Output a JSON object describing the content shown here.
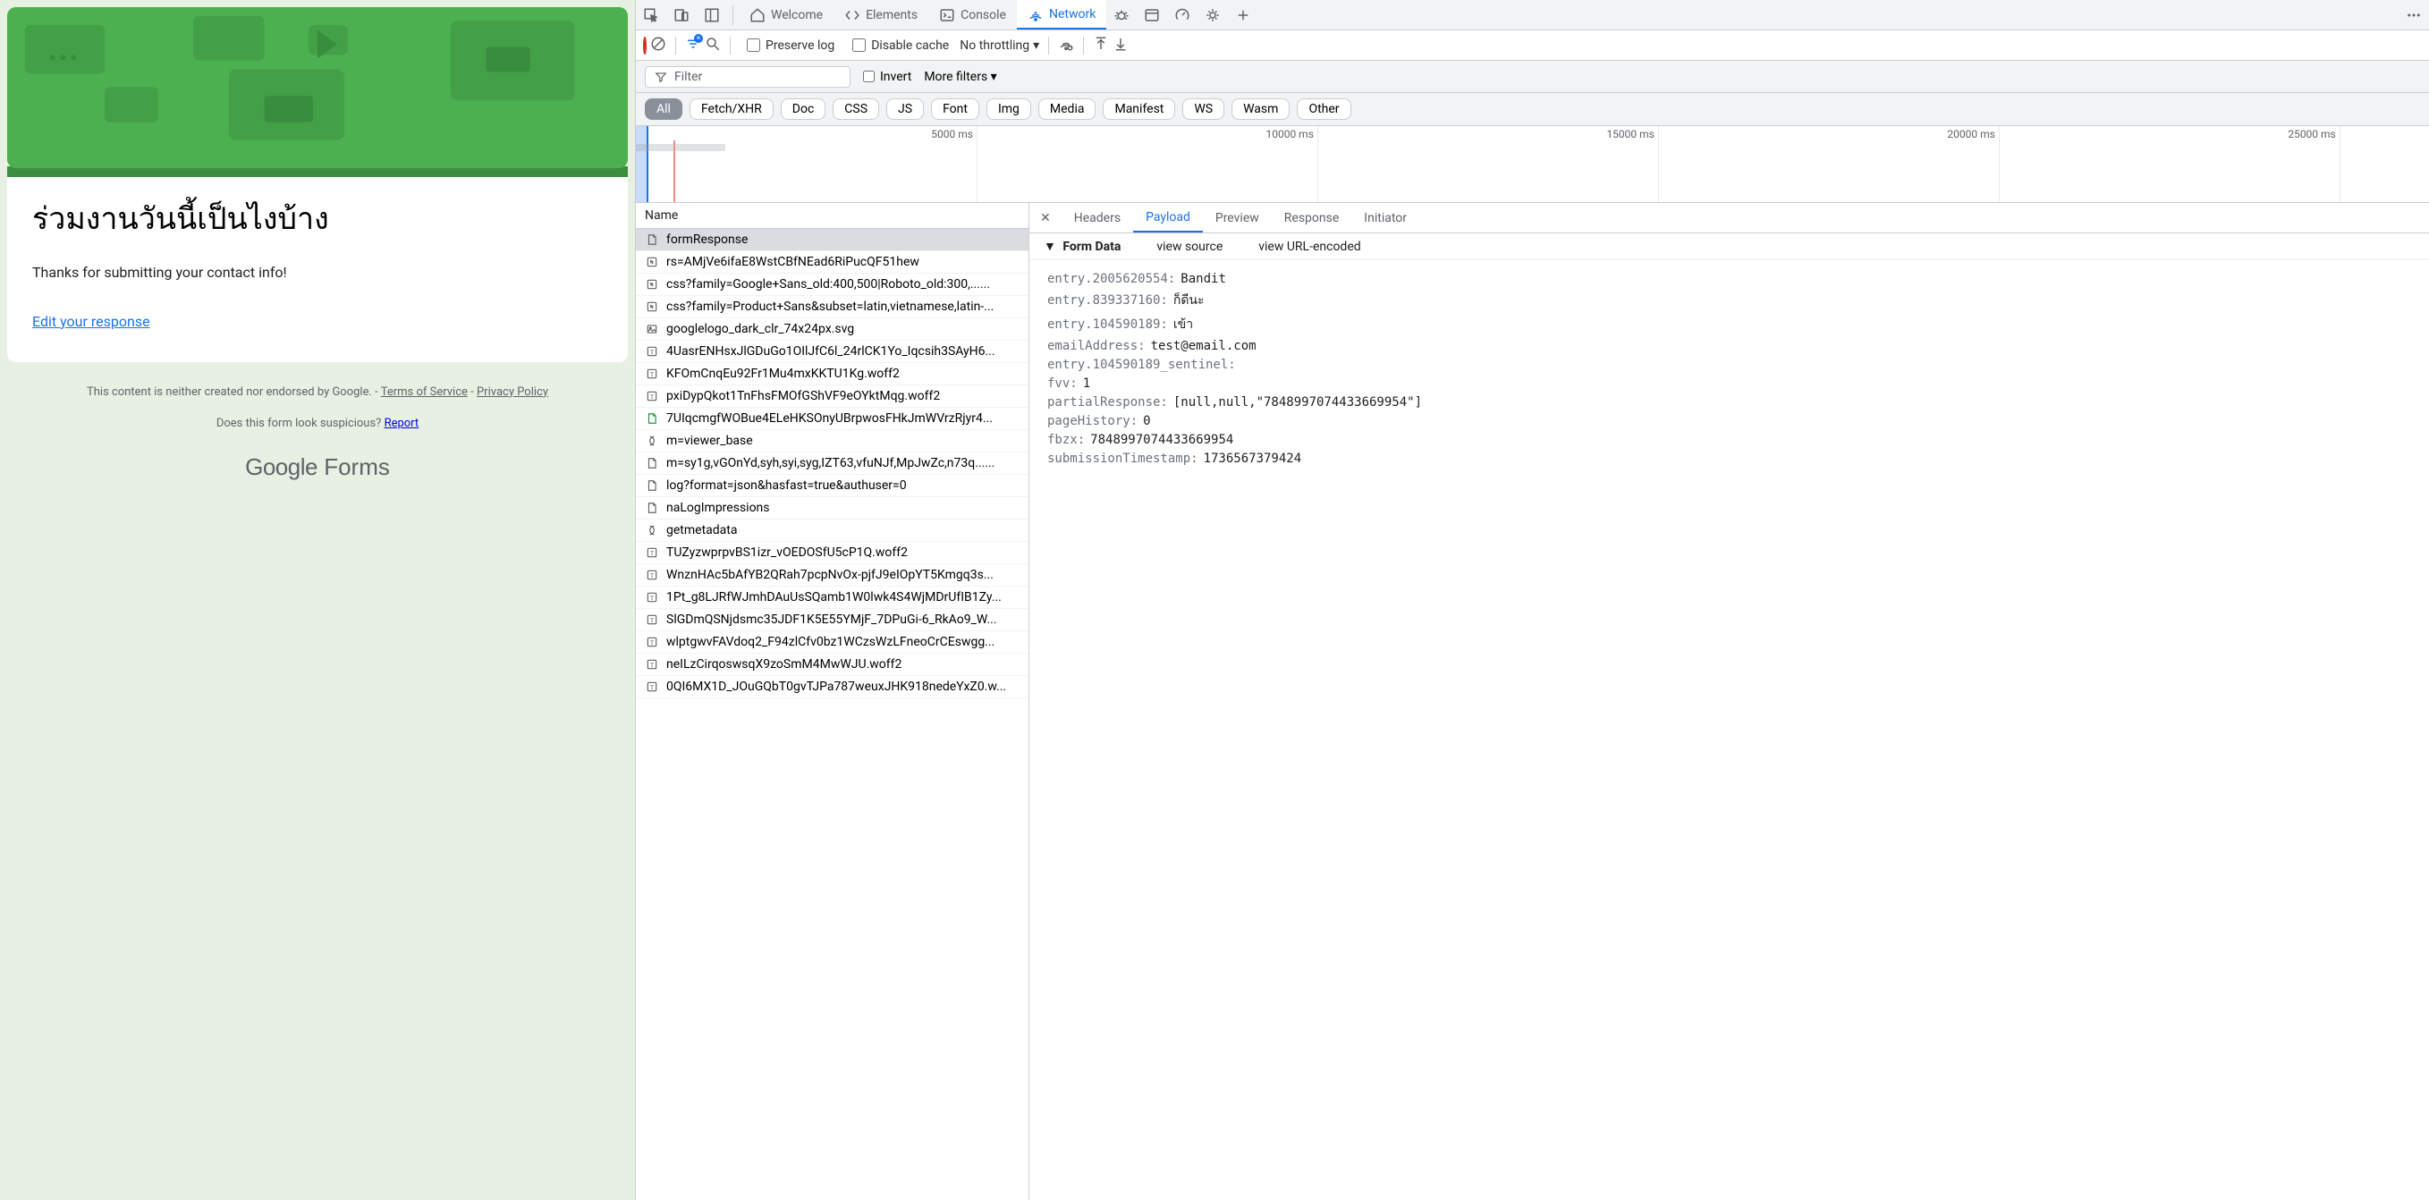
{
  "form": {
    "title": "ร่วมงานวันนี้เป็นไงบ้าง",
    "msg": "Thanks for submitting your contact info!",
    "edit": "Edit your response",
    "footer_prefix": "This content is neither created nor endorsed by Google. - ",
    "tos": "Terms of Service",
    "sep": " - ",
    "privacy": "Privacy Policy",
    "suspicious": "Does this form look suspicious? ",
    "report": "Report",
    "logo_g": "Google",
    "logo_f": " Forms"
  },
  "devtools": {
    "tabs": {
      "welcome": "Welcome",
      "elements": "Elements",
      "console": "Console",
      "network": "Network"
    },
    "toolbar": {
      "preserve": "Preserve log",
      "disable_cache": "Disable cache",
      "throttling": "No throttling"
    },
    "filterbar": {
      "filter": "Filter",
      "invert": "Invert",
      "more": "More filters"
    },
    "chips": [
      "All",
      "Fetch/XHR",
      "Doc",
      "CSS",
      "JS",
      "Font",
      "Img",
      "Media",
      "Manifest",
      "WS",
      "Wasm",
      "Other"
    ],
    "timeline_ticks": [
      "5000 ms",
      "10000 ms",
      "15000 ms",
      "20000 ms",
      "25000 ms"
    ],
    "name_header": "Name",
    "requests": [
      {
        "icon": "doc",
        "name": "formResponse",
        "sel": true
      },
      {
        "icon": "redirect",
        "name": "rs=AMjVe6ifaE8WstCBfNEad6RiPucQF51hew"
      },
      {
        "icon": "redirect",
        "name": "css?family=Google+Sans_old:400,500|Roboto_old:300,......"
      },
      {
        "icon": "redirect",
        "name": "css?family=Product+Sans&subset=latin,vietnamese,latin-..."
      },
      {
        "icon": "img",
        "name": "googlelogo_dark_clr_74x24px.svg"
      },
      {
        "icon": "font",
        "name": "4UasrENHsxJlGDuGo1OIlJfC6l_24rlCK1Yo_Iqcsih3SAyH6..."
      },
      {
        "icon": "font",
        "name": "KFOmCnqEu92Fr1Mu4mxKKTU1Kg.woff2"
      },
      {
        "icon": "font",
        "name": "pxiDypQkot1TnFhsFMOfGShVF9eOYktMqg.woff2"
      },
      {
        "icon": "js",
        "name": "7UIqcmgfWOBue4ELeHKSOnyUBrpwosFHkJmWVrzRjyr4..."
      },
      {
        "icon": "xhr",
        "name": "m=viewer_base"
      },
      {
        "icon": "doc",
        "name": "m=sy1g,vGOnYd,syh,syi,syg,IZT63,vfuNJf,MpJwZc,n73q......"
      },
      {
        "icon": "doc",
        "name": "log?format=json&hasfast=true&authuser=0"
      },
      {
        "icon": "doc",
        "name": "naLogImpressions"
      },
      {
        "icon": "xhr",
        "name": "getmetadata"
      },
      {
        "icon": "font",
        "name": "TUZyzwprpvBS1izr_vOEDOSfU5cP1Q.woff2"
      },
      {
        "icon": "font",
        "name": "WnznHAc5bAfYB2QRah7pcpNvOx-pjfJ9eIOpYT5Kmgq3s..."
      },
      {
        "icon": "font",
        "name": "1Pt_g8LJRfWJmhDAuUsSQamb1W0lwk4S4WjMDrUfIB1Zy..."
      },
      {
        "icon": "font",
        "name": "SlGDmQSNjdsmc35JDF1K5E55YMjF_7DPuGi-6_RkAo9_W..."
      },
      {
        "icon": "font",
        "name": "wlptgwvFAVdoq2_F94zlCfv0bz1WCzsWzLFneoCrCEswgg..."
      },
      {
        "icon": "font",
        "name": "neILzCirqoswsqX9zoSmM4MwWJU.woff2"
      },
      {
        "icon": "font",
        "name": "0QI6MX1D_JOuGQbT0gvTJPa787weuxJHK918nedeYxZ0.w..."
      }
    ],
    "detail_tabs": {
      "headers": "Headers",
      "payload": "Payload",
      "preview": "Preview",
      "response": "Response",
      "initiator": "Initiator"
    },
    "formdata_title": "Form Data",
    "view_source": "view source",
    "view_url": "view URL-encoded",
    "payload": [
      {
        "k": "entry.2005620554:",
        "v": "Bandit"
      },
      {
        "k": "entry.839337160:",
        "v": "ก็ดีนะ"
      },
      {
        "k": "entry.104590189:",
        "v": "เข้า"
      },
      {
        "k": "emailAddress:",
        "v": "test@email.com"
      },
      {
        "k": "entry.104590189_sentinel:",
        "v": ""
      },
      {
        "k": "fvv:",
        "v": "1"
      },
      {
        "k": "partialResponse:",
        "v": "[null,null,\"7848997074433669954\"]"
      },
      {
        "k": "pageHistory:",
        "v": "0"
      },
      {
        "k": "fbzx:",
        "v": "7848997074433669954"
      },
      {
        "k": "submissionTimestamp:",
        "v": "1736567379424"
      }
    ]
  }
}
